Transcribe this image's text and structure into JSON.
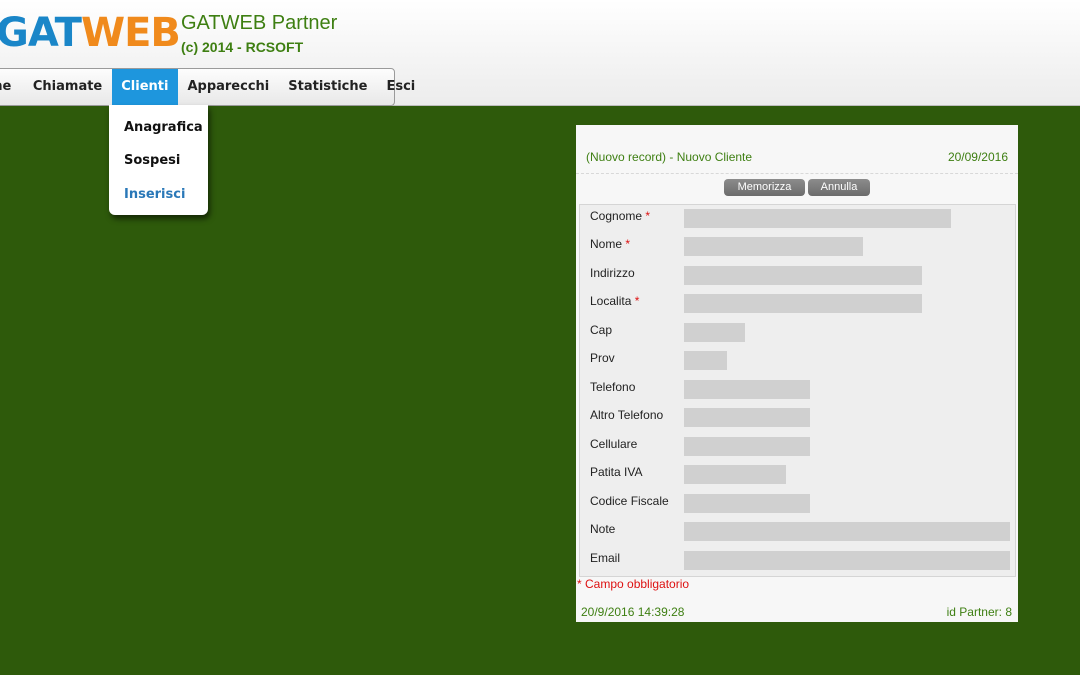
{
  "header": {
    "logo_a": "GAT",
    "logo_b": "WEB",
    "title": "GATWEB Partner",
    "copyright": "(c) 2014 - RCSOFT"
  },
  "menu": {
    "items": [
      "me",
      "Chiamate",
      "Clienti",
      "Apparecchi",
      "Statistiche",
      "Esci"
    ],
    "active": "Clienti"
  },
  "dropdown": {
    "items": [
      "Anagrafica",
      "Sospesi",
      "Inserisci"
    ],
    "selected": "Inserisci"
  },
  "form": {
    "header_left": "(Nuovo record) - Nuovo Cliente",
    "header_right": "20/09/2016",
    "save_label": "Memorizza",
    "cancel_label": "Annulla",
    "required_marker": "*",
    "fields": [
      {
        "label": "Cognome",
        "required": true,
        "value": ""
      },
      {
        "label": "Nome",
        "required": true,
        "value": ""
      },
      {
        "label": "Indirizzo",
        "required": false,
        "value": ""
      },
      {
        "label": "Localita",
        "required": true,
        "value": ""
      },
      {
        "label": "Cap",
        "required": false,
        "value": ""
      },
      {
        "label": "Prov",
        "required": false,
        "value": ""
      },
      {
        "label": "Telefono",
        "required": false,
        "value": ""
      },
      {
        "label": "Altro Telefono",
        "required": false,
        "value": ""
      },
      {
        "label": "Cellulare",
        "required": false,
        "value": ""
      },
      {
        "label": "Patita IVA",
        "required": false,
        "value": ""
      },
      {
        "label": "Codice Fiscale",
        "required": false,
        "value": ""
      },
      {
        "label": "Note",
        "required": false,
        "value": ""
      },
      {
        "label": "Email",
        "required": false,
        "value": ""
      }
    ],
    "mandatory_note": "* Campo obbligatorio",
    "footer_left": "20/9/2016 14:39:28",
    "footer_right": "id Partner: 8"
  },
  "colors": {
    "background": "#2e5a0b",
    "accent_green": "#3e7f12",
    "menu_active": "#1e96dd",
    "logo_blue": "#1a86c8",
    "logo_orange": "#f08a1c",
    "required": "#dd1111"
  }
}
